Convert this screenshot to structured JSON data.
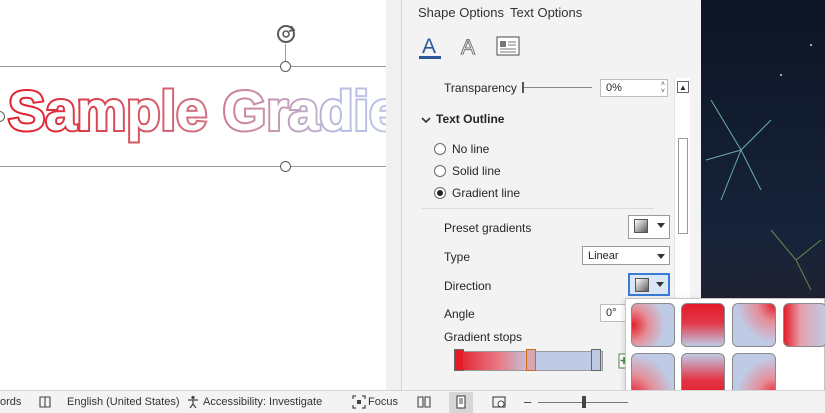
{
  "document": {
    "wordart_text": "Sample Gradient"
  },
  "pane": {
    "tabs": [
      "Shape Options",
      "Text Options"
    ],
    "icons": [
      "text-fill-outline-icon",
      "text-effects-icon",
      "layout-properties-icon"
    ],
    "transparency": {
      "label": "Transparency",
      "value": "0%"
    },
    "section_title": "Text Outline",
    "outline_options": [
      {
        "label": "No line",
        "checked": false
      },
      {
        "label": "Solid line",
        "checked": false
      },
      {
        "label": "Gradient line",
        "checked": true
      }
    ],
    "preset_gradients_label": "Preset gradients",
    "type": {
      "label": "Type",
      "value": "Linear"
    },
    "direction_label": "Direction",
    "angle": {
      "label": "Angle",
      "value": "0°"
    },
    "gradient_stops_label": "Gradient stops"
  },
  "status_bar": {
    "words": "ords",
    "language": "English (United States)",
    "accessibility": "Accessibility: Investigate",
    "focus": "Focus"
  },
  "colors": {
    "gradient_red": "#e31c2a",
    "gradient_blue": "#bfcbe6",
    "pane_bg": "#f3f3f3",
    "accent_blue": "#2b579a"
  }
}
